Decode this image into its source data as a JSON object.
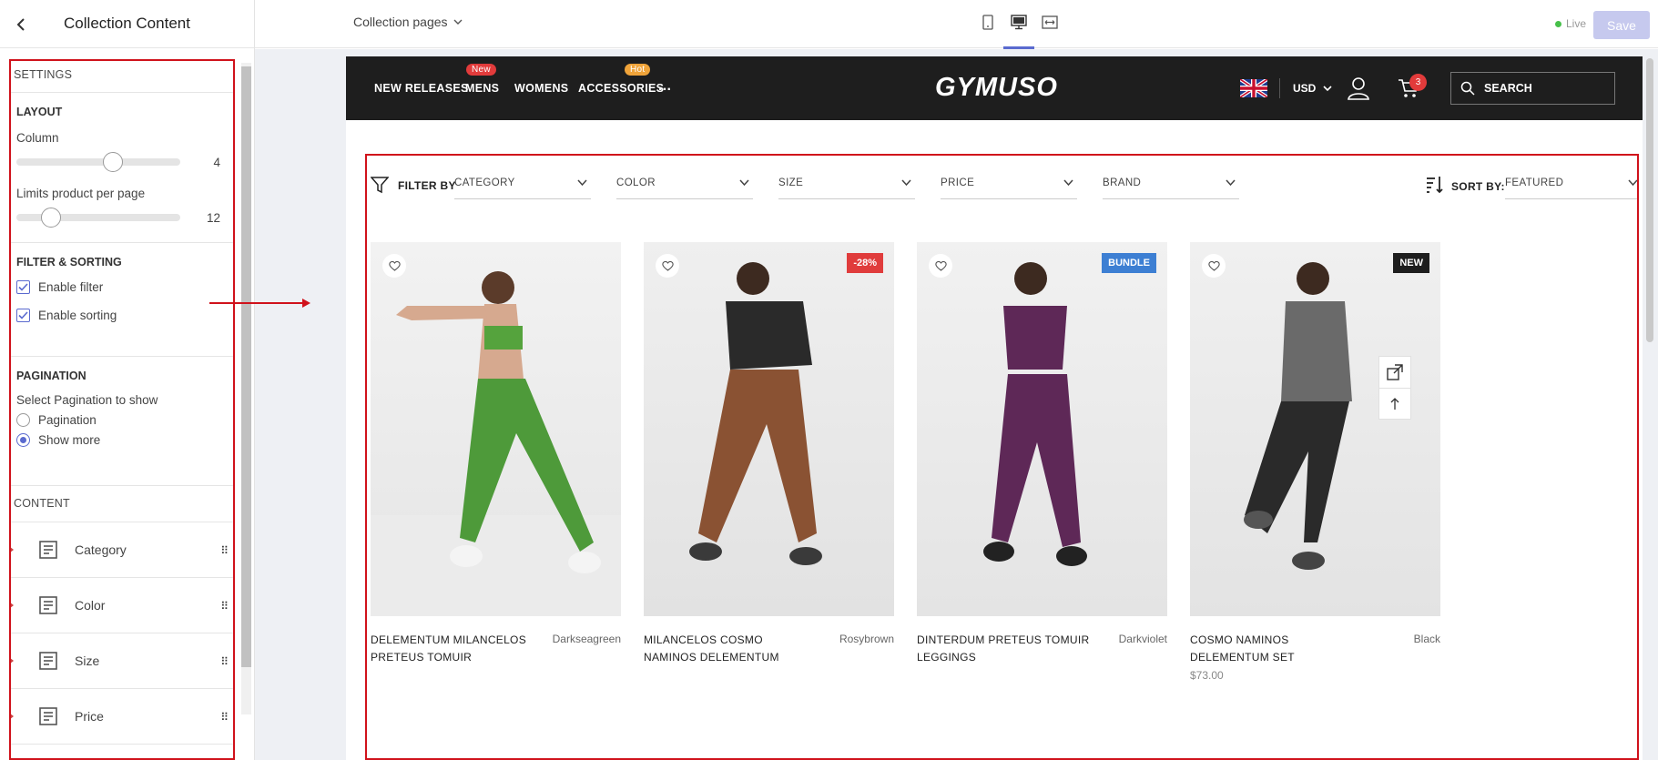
{
  "panel": {
    "title": "Collection Content",
    "settings_header": "SETTINGS",
    "layout": {
      "title": "LAYOUT",
      "column_label": "Column",
      "column_value": "4",
      "column_level": 0.5,
      "limit_label": "Limits product per page",
      "limit_value": "12",
      "limit_level": 0.2
    },
    "filter_sorting": {
      "title": "FILTER & SORTING",
      "enable_filter": "Enable filter",
      "enable_filter_checked": true,
      "enable_sorting": "Enable sorting",
      "enable_sorting_checked": true
    },
    "pagination": {
      "title": "PAGINATION",
      "label": "Select Pagination to show",
      "options": [
        "Pagination",
        "Show more"
      ],
      "selected": "Show more"
    },
    "content_header": "CONTENT",
    "content_items": [
      "Category",
      "Color",
      "Size",
      "Price"
    ]
  },
  "topbar": {
    "pages_select": "Collection pages",
    "devices": [
      "tablet",
      "desktop",
      "fullwidth"
    ],
    "active_device": "desktop",
    "live_label": "Live",
    "save_label": "Save"
  },
  "store": {
    "nav_items": [
      "NEW RELEASES",
      "MENS",
      "WOMENS",
      "ACCESSORIES",
      "..."
    ],
    "badges": {
      "mens": "New",
      "accessories": "Hot"
    },
    "badge_colors": {
      "new": "#e23b3b",
      "hot": "#f0a43a"
    },
    "logo": "GYMUSO",
    "currency": "USD",
    "cart_count": "3",
    "search_label": "SEARCH",
    "filter_by": "FILTER BY",
    "filters": [
      "CATEGORY",
      "COLOR",
      "SIZE",
      "PRICE",
      "BRAND"
    ],
    "sort_by_label": "SORT BY:",
    "sort_value": "FEATURED",
    "products": [
      {
        "name": "DELEMENTUM MILANCELOS PRETEUS TOMUIR",
        "color": "Darkseagreen",
        "price": "",
        "badge": "",
        "badge_color": "",
        "pants_color": "#4e9a3a",
        "top_color": "#55a33d"
      },
      {
        "name": "MILANCELOS COSMO NAMINOS DELEMENTUM",
        "color": "Rosybrown",
        "price": "",
        "badge": "-28%",
        "badge_color": "#e03c3c",
        "pants_color": "#8a5233",
        "top_color": "#2a2a2a"
      },
      {
        "name": "DINTERDUM PRETEUS TOMUIR LEGGINGS",
        "color": "Darkviolet",
        "price": "",
        "badge": "BUNDLE",
        "badge_color": "#3d7fd3",
        "pants_color": "#5e2857",
        "top_color": "#5e2857"
      },
      {
        "name": "COSMO NAMINOS DELEMENTUM SET",
        "color": "Black",
        "price": "$73.00",
        "badge": "NEW",
        "badge_color": "#1e1e1e",
        "pants_color": "#2a2a2a",
        "top_color": "#6a6a6a"
      }
    ]
  },
  "colors": {
    "accent": "#5a6acf",
    "highlight": "#d0121b",
    "live": "#47c04a"
  }
}
